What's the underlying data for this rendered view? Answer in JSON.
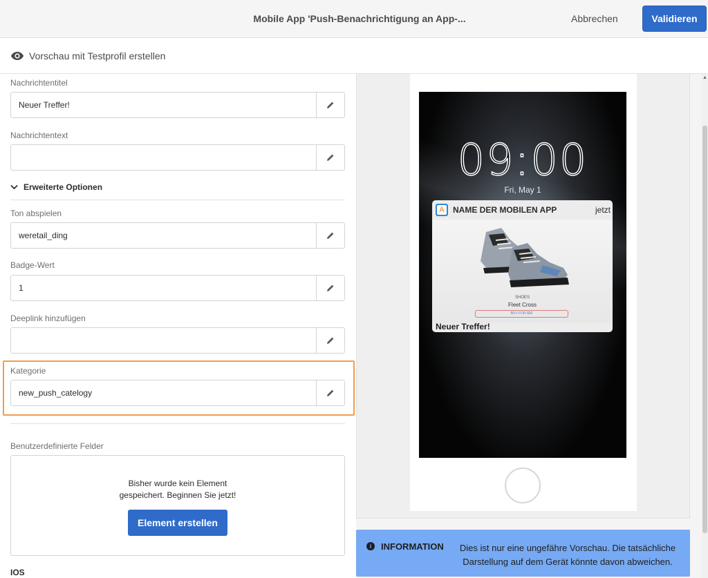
{
  "header": {
    "title": "Mobile App 'Push-Benachrichtigung an App-...",
    "cancel_label": "Abbrechen",
    "validate_label": "Validieren"
  },
  "preview_bar": {
    "label": "Vorschau mit Testprofil erstellen",
    "icon": "eye-icon"
  },
  "form": {
    "message_title": {
      "label": "Nachrichtentitel",
      "value": "Neuer Treffer!"
    },
    "message_text": {
      "label": "Nachrichtentext",
      "value": ""
    },
    "advanced_options_label": "Erweiterte Optionen",
    "sound": {
      "label": "Ton abspielen",
      "value": "weretail_ding"
    },
    "badge": {
      "label": "Badge-Wert",
      "value": "1"
    },
    "deeplink": {
      "label": "Deeplink hinzufügen",
      "value": ""
    },
    "category": {
      "label": "Kategorie",
      "value": "new_push_catelogy"
    },
    "custom_fields": {
      "label": "Benutzerdefinierte Felder",
      "empty_line1": "Bisher wurde kein Element",
      "empty_line2": "gespeichert. Beginnen Sie jetzt!",
      "create_label": "Element erstellen"
    },
    "ios_label": "IOS"
  },
  "phone_preview": {
    "clock": "09:00",
    "date": "Fri, May 1",
    "notification": {
      "app_name": "NAME DER MOBILEN APP",
      "time": "jetzt",
      "icon_letter": "A",
      "image_category": "SHOES",
      "image_product": "Fleet Cross",
      "image_button": "BUY FOR $65",
      "title": "Neuer Treffer!"
    }
  },
  "info": {
    "heading": "INFORMATION",
    "message": "Dies ist nur eine ungefähre Vorschau. Die tatsächliche Darstellung auf dem Gerät könnte davon abweichen."
  },
  "colors": {
    "accent": "#2f6bc9",
    "highlight": "#f29d49",
    "info_bg": "#77aaf4"
  }
}
